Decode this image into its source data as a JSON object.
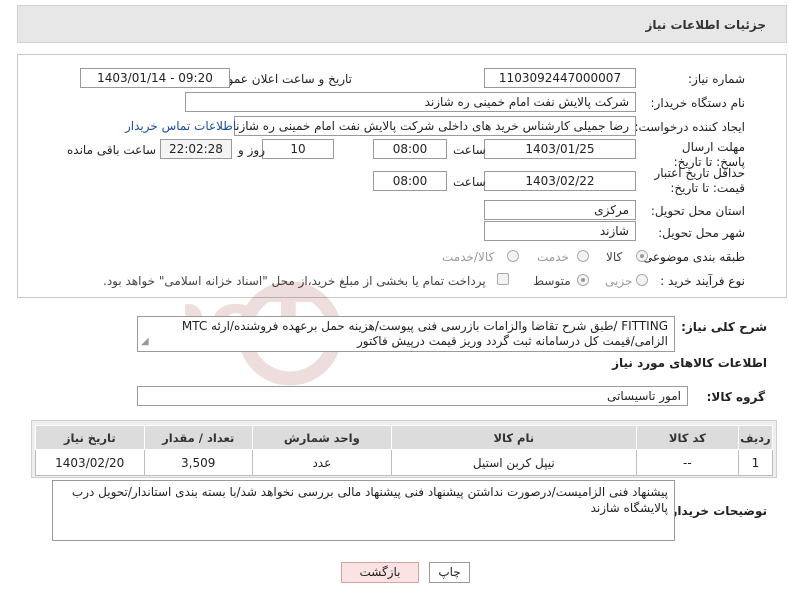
{
  "header": {
    "title": "جزئیات اطلاعات نیاز"
  },
  "form": {
    "need_number": {
      "label": "شماره نیاز:",
      "value": "1103092447000007"
    },
    "announce_datetime": {
      "label": "تاریخ و ساعت اعلان عمومی:",
      "value": "1403/01/14 - 09:20"
    },
    "buyer_org": {
      "label": "نام دستگاه خریدار:",
      "value": "شرکت پالایش نفت امام خمینی  ره  شازند"
    },
    "creator": {
      "label": "ایجاد کننده درخواست:",
      "value": "رضا جمیلی کارشناس خرید های داخلی  شرکت پالایش نفت امام خمینی  ره  شازند",
      "contact_link": "اطلاعات تماس خریدار"
    },
    "reply_deadline": {
      "label": "مهلت ارسال پاسخ: تا تاریخ:",
      "date": "1403/01/25",
      "time_label": "ساعت",
      "time": "08:00",
      "days": "10",
      "days_label": "روز و",
      "remaining": "22:02:28",
      "remaining_label": "ساعت باقی مانده"
    },
    "price_validity": {
      "label": "حداقل تاریخ اعتبار قیمت: تا تاریخ:",
      "date": "1403/02/22",
      "time_label": "ساعت",
      "time": "08:00"
    },
    "province": {
      "label": "استان محل تحویل:",
      "value": "مرکزی"
    },
    "city": {
      "label": "شهر محل تحویل:",
      "value": "شازند"
    },
    "category": {
      "label": "طبقه بندی موضوعی:",
      "options": [
        "کالا",
        "خدمت",
        "کالا/خدمت"
      ]
    },
    "purchase_type": {
      "label": "نوع فرآیند خرید :",
      "options": [
        "جزیی",
        "متوسط"
      ],
      "payment_note": "پرداخت تمام یا بخشی از مبلغ خرید،از محل \"اسناد خزانه اسلامی\" خواهد بود."
    }
  },
  "description": {
    "label": "شرح کلی نیاز:",
    "text": "FITTING /طبق شرح تقاضا والزامات بازرسی فنی پیوست/هزینه حمل برعهده فروشنده/ارئه MTC الزامی/قیمت کل درسامانه ثبت گردد وریز قیمت درپیش فاکتور"
  },
  "goods_info": {
    "title": "اطلاعات کالاهای مورد نیاز",
    "group_label": "گروه کالا:",
    "group_value": "امور تاسیساتی"
  },
  "table": {
    "headers": [
      "ردیف",
      "کد کالا",
      "نام کالا",
      "واحد شمارش",
      "تعداد / مقدار",
      "تاریخ نیاز"
    ],
    "rows": [
      [
        "1",
        "--",
        "نیپل کربن استیل",
        "عدد",
        "3,509",
        "1403/02/20"
      ]
    ]
  },
  "buyer_notes": {
    "label": "توضیحات خریدار:",
    "text": "پیشنهاد فنی الزامیست/درصورت نداشتن پیشنهاد فنی پیشنهاد مالی بررسی نخواهد شد/با بسته بندی استاندار/تحویل درب پالایشگاه شازند"
  },
  "buttons": {
    "print": "چاپ",
    "back": "بازگشت"
  },
  "watermark": {
    "text": "AriaTender.neT"
  },
  "colors": {
    "link": "#1a4fa0",
    "back_button_bg": "#fbe3e3",
    "header_bg": "#e7e7e7"
  }
}
